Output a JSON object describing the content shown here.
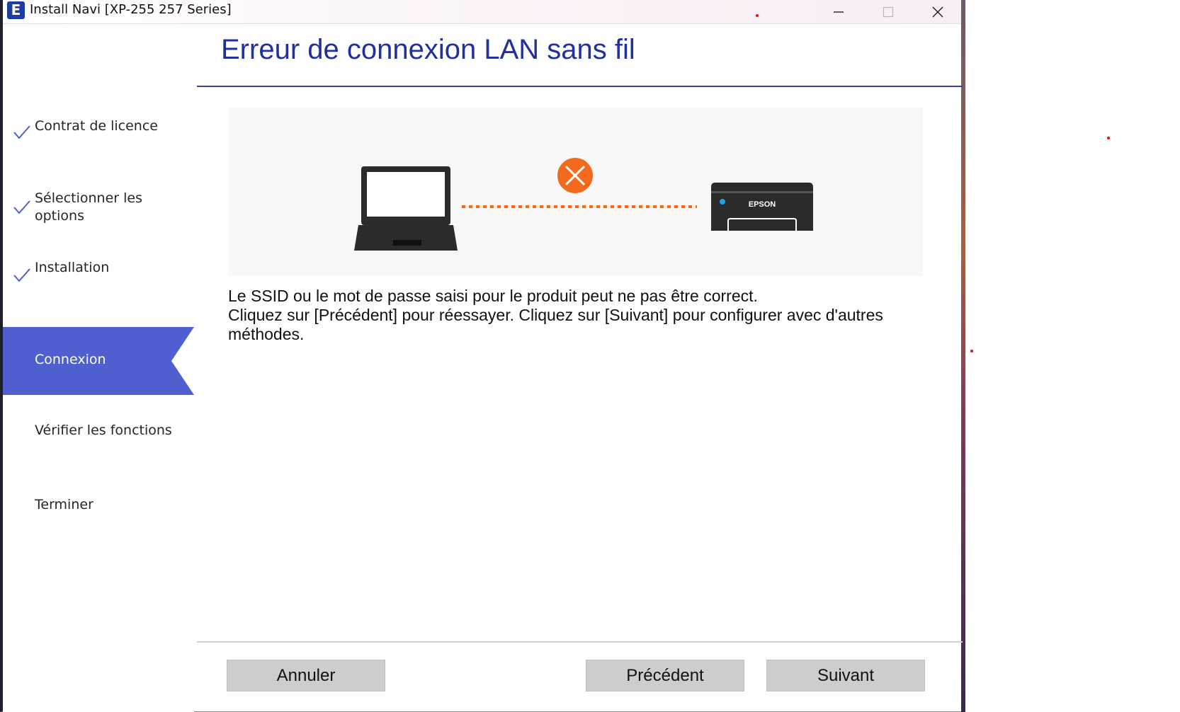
{
  "window": {
    "app_icon_letter": "E",
    "title": "Install Navi [XP-255 257 Series]"
  },
  "sidebar": {
    "steps": [
      {
        "label": "Contrat de licence",
        "done": true
      },
      {
        "label": "Sélectionner les options",
        "done": true
      },
      {
        "label": "Installation",
        "done": true
      },
      {
        "label": "Connexion",
        "active": true
      },
      {
        "label": "Vérifier les fonctions"
      },
      {
        "label": "Terminer"
      }
    ]
  },
  "main": {
    "title": "Erreur de connexion LAN sans fil",
    "illustration": {
      "printer_brand": "EPSON",
      "icons": [
        "laptop-icon",
        "error-x-icon",
        "printer-icon"
      ]
    },
    "message_lines": [
      "Le SSID ou le mot de passe saisi pour le produit peut ne pas être correct.",
      "Cliquez sur [Précédent] pour réessayer. Cliquez sur [Suivant] pour configurer avec d'autres méthodes."
    ]
  },
  "buttons": {
    "cancel": "Annuler",
    "back": "Précédent",
    "next": "Suivant"
  },
  "colors": {
    "accent": "#4f5fcf",
    "title": "#22309a",
    "error": "#f46a1d"
  }
}
